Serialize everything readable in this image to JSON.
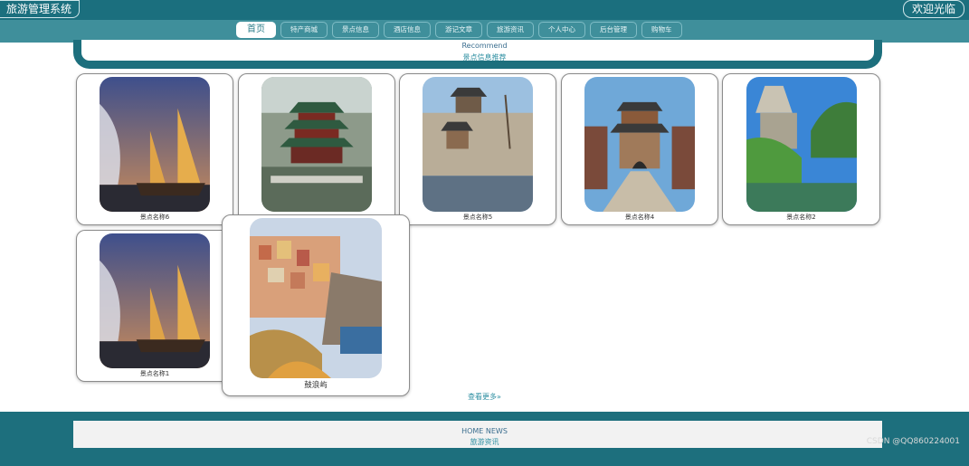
{
  "header": {
    "site_title": "旅游管理系统",
    "welcome": "欢迎光临"
  },
  "nav": {
    "items": [
      "首页",
      "特产商城",
      "景点信息",
      "酒店信息",
      "游记文章",
      "旅游资讯",
      "个人中心",
      "后台管理",
      "购物车"
    ]
  },
  "recommend": {
    "title_en": "Recommend",
    "title_cn": "景点信息推荐"
  },
  "cards": [
    {
      "name": "景点名称6",
      "image": "sailboat-photo"
    },
    {
      "name": "",
      "image": "pavilion-photo"
    },
    {
      "name": "景点名称5",
      "image": "city-gate-photo"
    },
    {
      "name": "景点名称4",
      "image": "ancient-town-photo"
    },
    {
      "name": "景点名称2",
      "image": "rock-mountain-photo"
    },
    {
      "name": "景点名称1",
      "image": "sailboat-photo"
    },
    {
      "name": "鼓浪屿",
      "image": "cliff-village-photo"
    }
  ],
  "more_link": "查看更多»",
  "news": {
    "title_en": "HOME NEWS",
    "title_cn": "旅游资讯"
  },
  "watermark": "CSDN @QQ860224001",
  "colors": {
    "primary": "#1d6f7d",
    "nav_bg": "#3f8f9b",
    "accent_text": "#2e8fa2"
  }
}
